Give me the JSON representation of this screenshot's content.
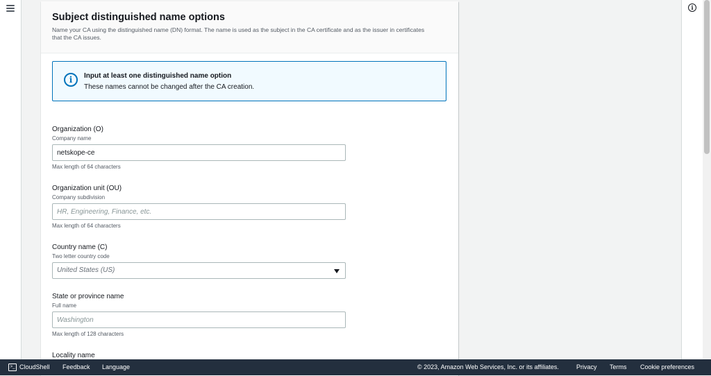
{
  "section": {
    "title": "Subject distinguished name options",
    "description": "Name your CA using the distinguished name (DN) format. The name is used as the subject in the CA certificate and as the issuer in certificates that the CA issues."
  },
  "alert": {
    "icon": "info-icon",
    "title": "Input at least one distinguished name option",
    "text": "These names cannot be changed after the CA creation."
  },
  "fields": {
    "organization": {
      "label": "Organization (O)",
      "description": "Company name",
      "value": "netskope-ce",
      "constraint": "Max length of 64 characters"
    },
    "org_unit": {
      "label": "Organization unit (OU)",
      "description": "Company subdivision",
      "placeholder": "HR, Engineering, Finance, etc.",
      "constraint": "Max length of 64 characters"
    },
    "country": {
      "label": "Country name (C)",
      "description": "Two letter country code",
      "placeholder": "United States (US)"
    },
    "state": {
      "label": "State or province name",
      "description": "Full name",
      "placeholder": "Washington",
      "constraint": "Max length of 128 characters"
    },
    "locality": {
      "label": "Locality name"
    }
  },
  "footer": {
    "cloudshell": "CloudShell",
    "feedback": "Feedback",
    "language": "Language",
    "copyright": "© 2023, Amazon Web Services, Inc. or its affiliates.",
    "privacy": "Privacy",
    "terms": "Terms",
    "cookie": "Cookie preferences"
  },
  "colors": {
    "footer_bg": "#232f3e",
    "info_blue": "#0073bb",
    "alert_bg": "#f1faff"
  }
}
